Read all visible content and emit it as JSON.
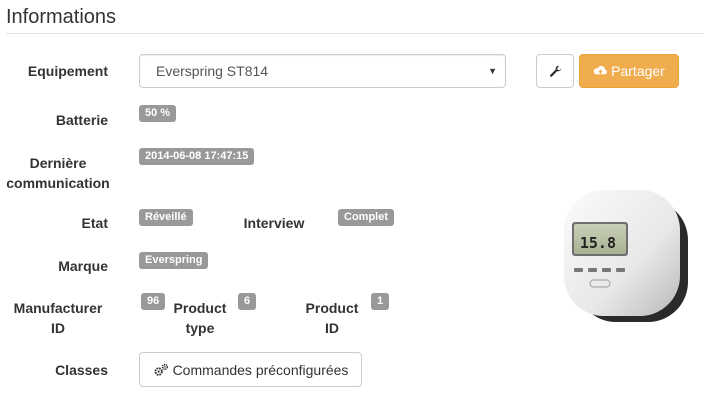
{
  "section": {
    "title": "Informations"
  },
  "labels": {
    "equipement": "Equipement",
    "batterie": "Batterie",
    "derniere_1": "Dernière",
    "derniere_2": "communication",
    "etat": "Etat",
    "interview": "Interview",
    "marque": "Marque",
    "manufacturer_1": "Manufacturer",
    "manufacturer_2": "ID",
    "product_type_1": "Product",
    "product_type_2": "type",
    "product_id_1": "Product",
    "product_id_2": "ID",
    "classes": "Classes"
  },
  "equipement": {
    "selected": "Everspring ST814"
  },
  "values": {
    "batterie": "50 %",
    "derniere_communication": "2014-06-08 17:47:15",
    "etat": "Réveillé",
    "interview": "Complet",
    "marque": "Everspring",
    "manufacturer_id": "96",
    "product_type": "6",
    "product_id": "1"
  },
  "buttons": {
    "partager": "Partager",
    "commandes": "Commandes préconfigurées"
  },
  "device_display": {
    "reading": "15.8"
  },
  "colors": {
    "badge": "#999999",
    "share_button": "#f0ad4e",
    "text": "#333333"
  },
  "icons": {
    "wrench": "wrench-icon",
    "share": "cloud-upload-icon",
    "commands": "cogs-icon",
    "dropdown": "caret-down-icon"
  }
}
